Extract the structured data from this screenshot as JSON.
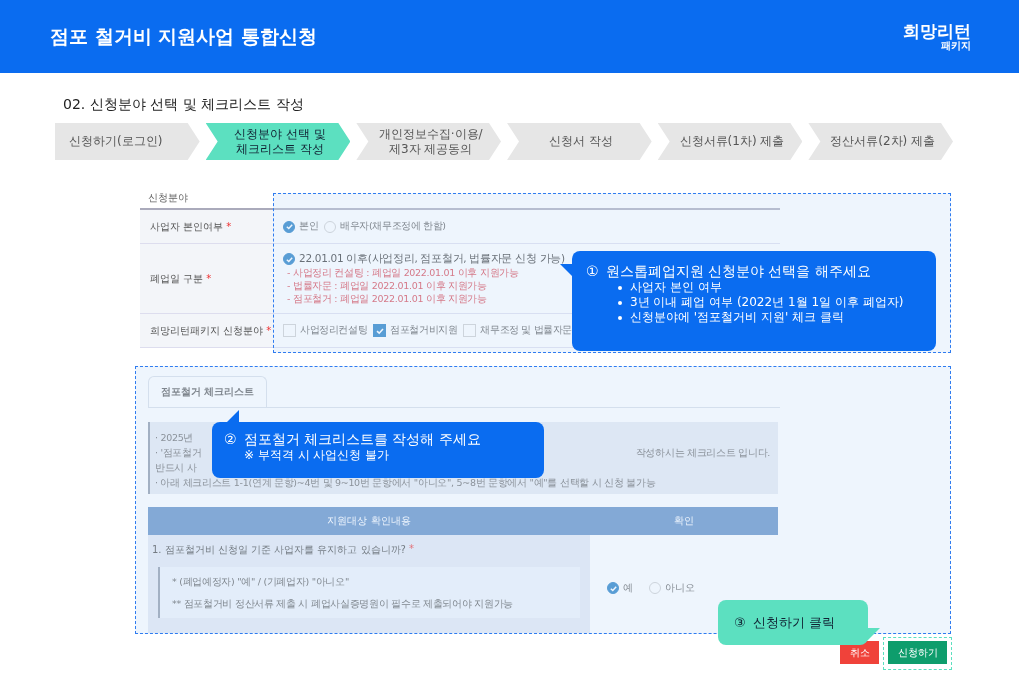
{
  "header": {
    "title": "점포 철거비 지원사업 통합신청",
    "logo": {
      "name": "희망리턴",
      "sub": "패키지"
    }
  },
  "section_title": "02. 신청분야 선택 및 체크리스트 작성",
  "steps": [
    {
      "label": "신청하기(로그인)",
      "selected": false
    },
    {
      "label": "신청분야 선택 및\n체크리스트 작성",
      "selected": true
    },
    {
      "label": "개인정보수집·이용/\n제3자 제공동의",
      "selected": false
    },
    {
      "label": "신청서 작성",
      "selected": false
    },
    {
      "label": "신청서류(1차) 제출",
      "selected": false
    },
    {
      "label": "정산서류(2차) 제출",
      "selected": false
    }
  ],
  "form": {
    "section_label": "신청분야",
    "rows": [
      {
        "label": "사업자 본인여부",
        "required_mark": "*",
        "kind": "radio",
        "options": [
          {
            "label": "본인",
            "selected": true
          },
          {
            "label": "배우자(채무조정에 한함)",
            "selected": false
          }
        ]
      },
      {
        "label": "폐업일 구분",
        "required_mark": "*",
        "kind": "radio",
        "options": [
          {
            "label": "22.01.01 이후(사업정리, 점포철거, 법률자문 신청 가능)",
            "selected": true
          }
        ],
        "notes": [
          "- 사업정리 컨설팅 : 폐업일 2022.01.01 이후 지원가능",
          "- 법률자문 : 폐업일 2022.01.01 이후 지원가능",
          "- 점포철거 : 폐업일 2022.01.01 이후 지원가능"
        ]
      },
      {
        "label": "희망리턴패키지 신청분야",
        "required_mark": "*",
        "kind": "checkbox",
        "options": [
          {
            "label": "사업정리컨설팅",
            "checked": false
          },
          {
            "label": "점포철거비지원",
            "checked": true
          },
          {
            "label": "채무조정 및 법률자문",
            "checked": false
          }
        ]
      }
    ]
  },
  "checklist": {
    "tab": {
      "label": "점포철거 체크리스트"
    },
    "notice_lines": [
      {
        "left": "· 2025년"
      },
      {
        "left": "· '점포철거",
        "right": "작성하시는 체크리스트 입니다."
      },
      {
        "left": "반드시 사"
      },
      {
        "left": "· 아래 체크리스트 1-1(연계 문항)~4번 및 9~10번 문항에서 \"아니오\", 5~8번 문항에서 \"예\"를 선택할 시 신청 불가능"
      }
    ],
    "columns": [
      "지원대상 확인내용",
      "확인"
    ],
    "question": {
      "text": "1. 점포철거비 신청일 기준 사업자를 유지하고 있습니까?",
      "required_mark": "*",
      "hints": [
        "* (폐업예정자) \"예\" / (기폐업자) \"아니오\"",
        "** 점포철거비 정산서류 제출 시 폐업사실증명원이 필수로 제출되어야 지원가능"
      ],
      "answers": [
        {
          "label": "예",
          "selected": true
        },
        {
          "label": "아니오",
          "selected": false
        }
      ]
    }
  },
  "buttons": [
    {
      "label": "취소",
      "kind": "cancel"
    },
    {
      "label": "신청하기",
      "kind": "submit"
    }
  ],
  "callouts": [
    {
      "kind": "blue",
      "number": "①",
      "title": "원스톱폐업지원 신청분야 선택을 해주세요",
      "lines": [
        "사업자 본인 여부",
        "3년 이내 폐업 여부 (2022년 1월 1일 이후 폐업자)",
        "신청분야에 '점포철거비 지원' 체크 클릭"
      ]
    },
    {
      "kind": "blue2",
      "number": "②",
      "title": "점포철거 체크리스트를 작성해 주세요",
      "lines": [
        "※ 부적격 시 사업신청 불가"
      ]
    },
    {
      "kind": "teal",
      "number": "③",
      "title": "신청하기 클릭"
    }
  ]
}
